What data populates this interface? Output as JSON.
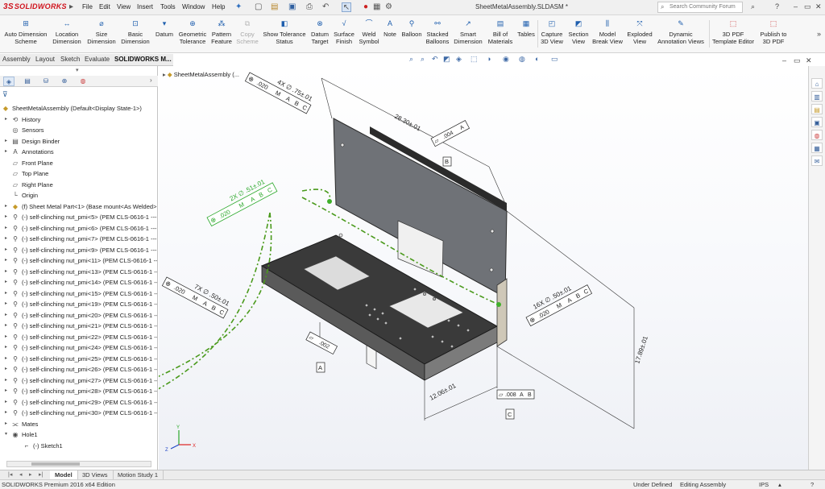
{
  "app": {
    "brand": "SOLIDWORKS",
    "brand_mark": "3S",
    "title": "SheetMetalAssembly.SLDASM *",
    "menus": [
      "File",
      "Edit",
      "View",
      "Insert",
      "Tools",
      "Window",
      "Help"
    ],
    "search_placeholder": "Search Community Forum"
  },
  "ribbon": {
    "buttons": [
      {
        "label": "Auto Dimension Scheme",
        "icon": "auto-dimension-icon"
      },
      {
        "label": "Location Dimension",
        "icon": "location-dimension-icon"
      },
      {
        "label": "Size Dimension",
        "icon": "size-dimension-icon"
      },
      {
        "label": "Basic Dimension",
        "icon": "basic-dimension-icon"
      },
      {
        "label": "Datum",
        "icon": "datum-icon"
      },
      {
        "label": "Geometric Tolerance",
        "icon": "geometric-tolerance-icon"
      },
      {
        "label": "Pattern Feature",
        "icon": "pattern-feature-icon"
      },
      {
        "label": "Copy Scheme",
        "icon": "copy-scheme-icon"
      },
      {
        "label": "Show Tolerance Status",
        "icon": "tolerance-status-icon"
      },
      {
        "label": "Datum Target",
        "icon": "datum-target-icon"
      },
      {
        "label": "Surface Finish",
        "icon": "surface-finish-icon"
      },
      {
        "label": "Weld Symbol",
        "icon": "weld-symbol-icon"
      },
      {
        "label": "Note",
        "icon": "note-icon"
      },
      {
        "label": "Balloon",
        "icon": "balloon-icon"
      },
      {
        "label": "Stacked Balloons",
        "icon": "stacked-balloons-icon"
      },
      {
        "label": "Smart Dimension",
        "icon": "smart-dimension-icon"
      },
      {
        "label": "Bill of Materials",
        "icon": "bill-of-materials-icon"
      },
      {
        "label": "Tables",
        "icon": "tables-icon"
      },
      {
        "label": "Capture 3D View",
        "icon": "capture-3d-view-icon"
      },
      {
        "label": "Section View",
        "icon": "section-view-icon"
      },
      {
        "label": "Model Break View",
        "icon": "model-break-view-icon"
      },
      {
        "label": "Exploded View",
        "icon": "exploded-view-icon"
      },
      {
        "label": "Dynamic Annotation Views",
        "icon": "dynamic-annotation-icon"
      },
      {
        "label": "3D PDF Template Editor",
        "icon": "pdf-template-icon"
      },
      {
        "label": "Publish to 3D PDF",
        "icon": "publish-pdf-icon"
      }
    ]
  },
  "cm_tabs": [
    "Assembly",
    "Layout",
    "Sketch",
    "Evaluate",
    "SOLIDWORKS M..."
  ],
  "feature_tree": {
    "root": "SheetMetalAssembly  (Default<Display State-1>)",
    "items": [
      {
        "label": "History",
        "icon": "history-icon"
      },
      {
        "label": "Sensors",
        "icon": "sensors-icon"
      },
      {
        "label": "Design Binder",
        "icon": "design-binder-icon"
      },
      {
        "label": "Annotations",
        "icon": "annotations-icon"
      },
      {
        "label": "Front Plane",
        "icon": "plane-icon"
      },
      {
        "label": "Top Plane",
        "icon": "plane-icon"
      },
      {
        "label": "Right Plane",
        "icon": "plane-icon"
      },
      {
        "label": "Origin",
        "icon": "origin-icon"
      },
      {
        "label": "(f) Sheet Metal Part<1> (Base mount<As Welded>",
        "icon": "sheet-metal-part-icon"
      },
      {
        "label": "(-) self-clinching nut_pmi<5> (PEM CLS-0616-1 ---N",
        "icon": "part-icon"
      },
      {
        "label": "(-) self-clinching nut_pmi<6> (PEM CLS-0616-1 ---N",
        "icon": "part-icon"
      },
      {
        "label": "(-) self-clinching nut_pmi<7> (PEM CLS-0616-1 ---N",
        "icon": "part-icon"
      },
      {
        "label": "(-) self-clinching nut_pmi<9> (PEM CLS-0616-1 ---N",
        "icon": "part-icon"
      },
      {
        "label": "(-) self-clinching nut_pmi<11> (PEM CLS-0616-1 ---",
        "icon": "part-icon"
      },
      {
        "label": "(-) self-clinching nut_pmi<13> (PEM CLS-0616-1 ---",
        "icon": "part-icon"
      },
      {
        "label": "(-) self-clinching nut_pmi<14> (PEM CLS-0616-1 ---",
        "icon": "part-icon"
      },
      {
        "label": "(-) self-clinching nut_pmi<15> (PEM CLS-0616-1 ---",
        "icon": "part-icon"
      },
      {
        "label": "(-) self-clinching nut_pmi<19> (PEM CLS-0616-1 ---",
        "icon": "part-icon"
      },
      {
        "label": "(-) self-clinching nut_pmi<20> (PEM CLS-0616-1 ---",
        "icon": "part-icon"
      },
      {
        "label": "(-) self-clinching nut_pmi<21> (PEM CLS-0616-1 ---",
        "icon": "part-icon"
      },
      {
        "label": "(-) self-clinching nut_pmi<22> (PEM CLS-0616-1 ---",
        "icon": "part-icon"
      },
      {
        "label": "(-) self-clinching nut_pmi<24> (PEM CLS-0616-1 ---",
        "icon": "part-icon"
      },
      {
        "label": "(-) self-clinching nut_pmi<25> (PEM CLS-0616-1 ---",
        "icon": "part-icon"
      },
      {
        "label": "(-) self-clinching nut_pmi<26> (PEM CLS-0616-1 ---",
        "icon": "part-icon"
      },
      {
        "label": "(-) self-clinching nut_pmi<27> (PEM CLS-0616-1 ---",
        "icon": "part-icon"
      },
      {
        "label": "(-) self-clinching nut_pmi<28> (PEM CLS-0616-1 ---",
        "icon": "part-icon"
      },
      {
        "label": "(-) self-clinching nut_pmi<29> (PEM CLS-0616-1 ---",
        "icon": "part-icon"
      },
      {
        "label": "(-) self-clinching nut_pmi<30> (PEM CLS-0616-1 ---",
        "icon": "part-icon"
      },
      {
        "label": "Mates",
        "icon": "mates-icon"
      },
      {
        "label": "Hole1",
        "icon": "hole-icon"
      },
      {
        "label": "(-) Sketch1",
        "icon": "sketch-icon"
      }
    ]
  },
  "viewport": {
    "tree_label": "SheetMetalAssembly  (...",
    "annotations": {
      "hole_top_qty": "4X ∅ .75±.01",
      "hole_top_tol": ".020",
      "dim_width": "28.30±.01",
      "datum_flat_tol": ".004",
      "datum_b": "B",
      "datum_a": "A",
      "datum_c": "C",
      "hole_green_qty": "2X ∅ .51±.01",
      "hole_green_tol": ".020",
      "hole_left_qty": "7X ∅ .50±.01",
      "hole_left_tol": ".020",
      "hole_right_qty": "16X ∅ .50±.01",
      "hole_right_tol": ".020",
      "flat_front_tol": ".002",
      "dim_height": "17.89±.01",
      "dim_depth": "12.06±.01",
      "flat_bottom_tol": ".008",
      "mmc": "M"
    }
  },
  "bottom_tabs": [
    "Model",
    "3D Views",
    "Motion Study 1"
  ],
  "status": {
    "edition": "SOLIDWORKS Premium 2016 x64 Edition",
    "state": "Under Defined",
    "mode": "Editing Assembly",
    "units": "IPS"
  },
  "colors": {
    "brand_red": "#d0121c",
    "pmi_selected_green": "#2aa82a",
    "leader_green": "#4a9a1c"
  }
}
